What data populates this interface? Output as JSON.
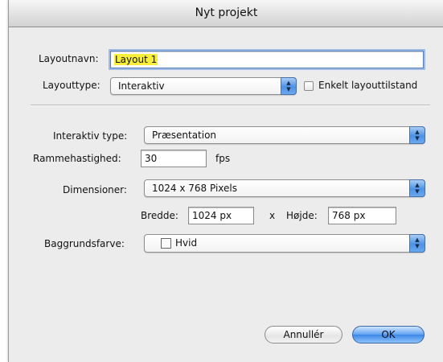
{
  "window": {
    "title": "Nyt projekt"
  },
  "layout": {
    "name_label": "Layoutnavn:",
    "name_value": "Layout 1",
    "type_label": "Layouttype:",
    "type_value": "Interaktiv",
    "single_state_label": "Enkelt layouttilstand",
    "single_state_checked": false
  },
  "interactive": {
    "type_label": "Interaktiv type:",
    "type_value": "Præsentation",
    "framerate_label": "Rammehastighed:",
    "framerate_value": "30",
    "framerate_unit": "fps"
  },
  "dimensions": {
    "label": "Dimensioner:",
    "value": "1024 x 768 Pixels",
    "width_label": "Bredde:",
    "width_value": "1024 px",
    "times": "x",
    "height_label": "Højde:",
    "height_value": "768 px"
  },
  "background": {
    "label": "Baggrundsfarve:",
    "value": "Hvid",
    "swatch_color": "#ffffff"
  },
  "buttons": {
    "cancel": "Annullér",
    "ok": "OK"
  },
  "icons": {
    "popup_arrows": "popup-arrows-icon",
    "color_swatch": "color-swatch-icon"
  }
}
